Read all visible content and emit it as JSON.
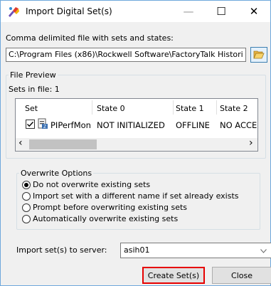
{
  "window": {
    "title": "Import Digital Set(s)",
    "controls": {
      "minimize": "—",
      "maximize": "☐",
      "close": "✕"
    }
  },
  "file_section": {
    "label": "Comma delimited file with sets and states:",
    "path_value": "C:\\Program Files (x86)\\Rockwell Software\\FactoryTalk Histori",
    "browse_icon": "folder-open-icon"
  },
  "file_preview": {
    "legend": "File Preview",
    "sets_in_file": "Sets in file: 1",
    "columns": [
      "Set",
      "State 0",
      "State 1",
      "State 2"
    ],
    "rows": [
      {
        "checked": true,
        "set": "PIPerfMon",
        "state0": "NOT INITIALIZED",
        "state1": "OFFLINE",
        "state2": "NO ACCESS"
      }
    ],
    "scroll_left": "‹",
    "scroll_right": "›"
  },
  "overwrite_options": {
    "legend": "Overwrite Options",
    "options": [
      {
        "label": "Do not overwrite existing sets",
        "selected": true
      },
      {
        "label": "Import set with a different name if set already exists",
        "selected": false
      },
      {
        "label": "Prompt before overwriting existing sets",
        "selected": false
      },
      {
        "label": "Automatically overwrite existing sets",
        "selected": false
      }
    ]
  },
  "server": {
    "label": "Import set(s) to server:",
    "value": "asih01"
  },
  "buttons": {
    "create": "Create Set(s)",
    "close": "Close"
  }
}
